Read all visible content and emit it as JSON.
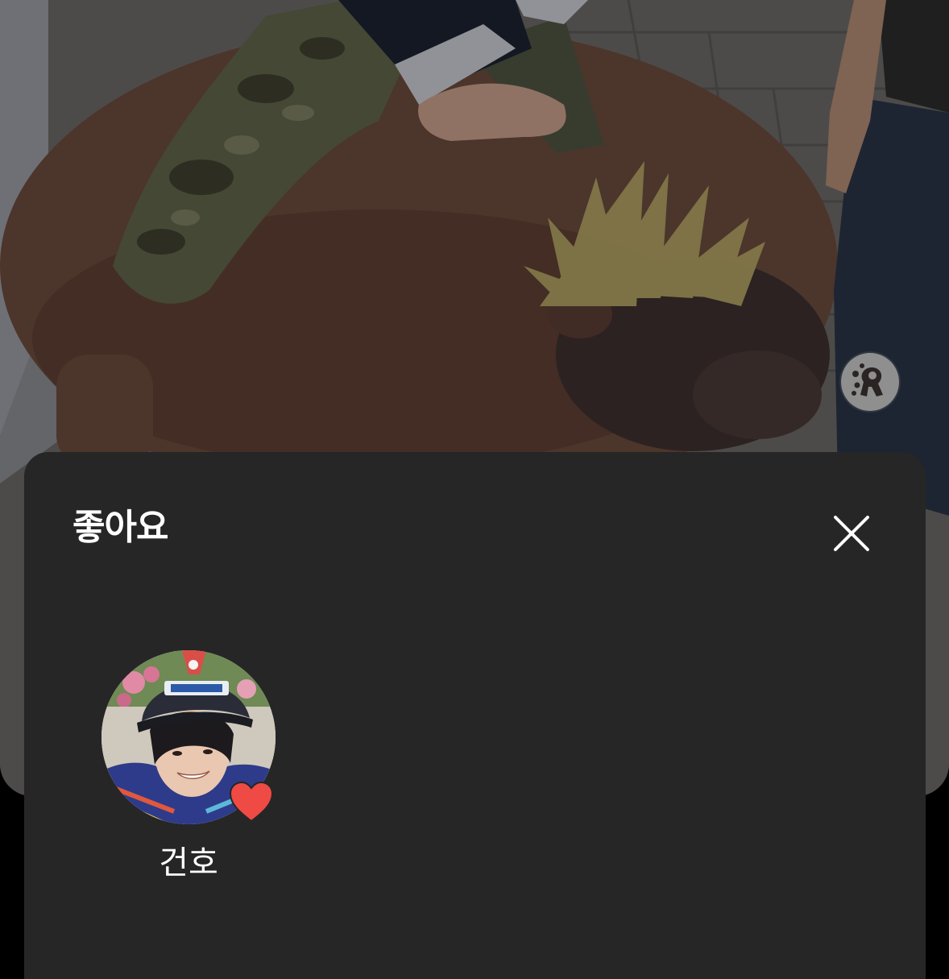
{
  "likes_sheet": {
    "title": "좋아요",
    "close_icon": "close-icon",
    "likers": [
      {
        "name": "건호",
        "avatar_icon": "avatar",
        "reaction_icon": "heart-icon",
        "reaction_color": "#f04a45"
      }
    ]
  },
  "story": {
    "sticker_icon": "sticker-icon"
  },
  "colors": {
    "sheet_background": "#262627",
    "text": "#ffffff",
    "heart": "#f04a45"
  }
}
